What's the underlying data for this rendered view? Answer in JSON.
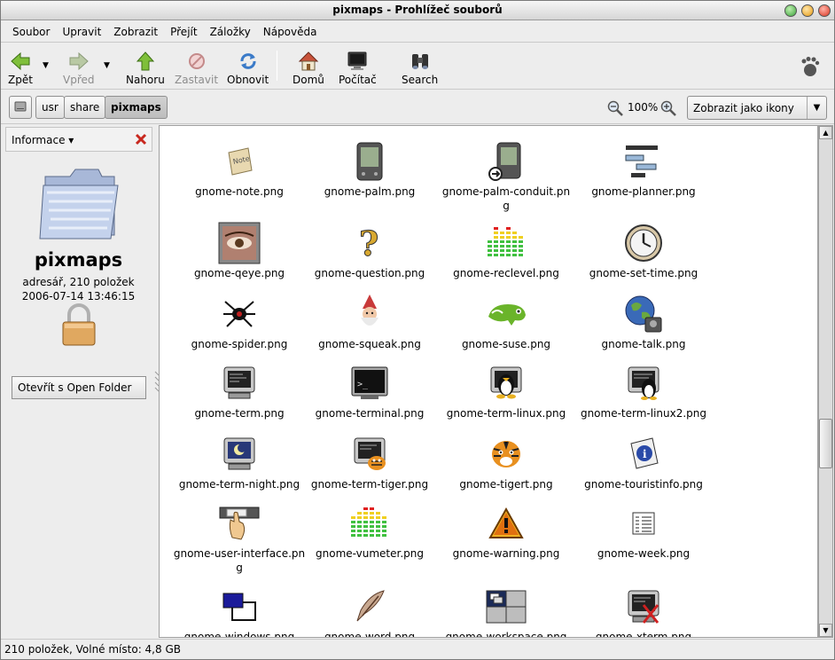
{
  "window": {
    "title": "pixmaps - Prohlížeč souborů"
  },
  "menu": [
    "Soubor",
    "Upravit",
    "Zobrazit",
    "Přejít",
    "Záložky",
    "Nápověda"
  ],
  "toolbar": {
    "back": "Zpět",
    "forward": "Vpřed",
    "up": "Nahoru",
    "stop": "Zastavit",
    "reload": "Obnovit",
    "home": "Domů",
    "computer": "Počítač",
    "search": "Search"
  },
  "location": {
    "crumbs": [
      "usr",
      "share",
      "pixmaps"
    ],
    "zoom": "100%",
    "view": "Zobrazit jako ikony"
  },
  "sidebar": {
    "panel": "Informace",
    "folder_name": "pixmaps",
    "info": "adresář, 210 položek",
    "date": "2006-07-14 13:46:15",
    "open_button": "Otevřít s Open Folder"
  },
  "files": [
    "gnome-note.png",
    "gnome-palm.png",
    "gnome-palm-conduit.png",
    "gnome-planner.png",
    "gnome-qeye.png",
    "gnome-question.png",
    "gnome-reclevel.png",
    "gnome-set-time.png",
    "gnome-spider.png",
    "gnome-squeak.png",
    "gnome-suse.png",
    "gnome-talk.png",
    "gnome-term.png",
    "gnome-terminal.png",
    "gnome-term-linux.png",
    "gnome-term-linux2.png",
    "gnome-term-night.png",
    "gnome-term-tiger.png",
    "gnome-tigert.png",
    "gnome-touristinfo.png",
    "gnome-user-interface.png",
    "gnome-vumeter.png",
    "gnome-warning.png",
    "gnome-week.png",
    "gnome-windows.png",
    "gnome-word.png",
    "gnome-workspace.png",
    "gnome-xterm.png"
  ],
  "status": "210 položek, Volné místo: 4,8 GB"
}
